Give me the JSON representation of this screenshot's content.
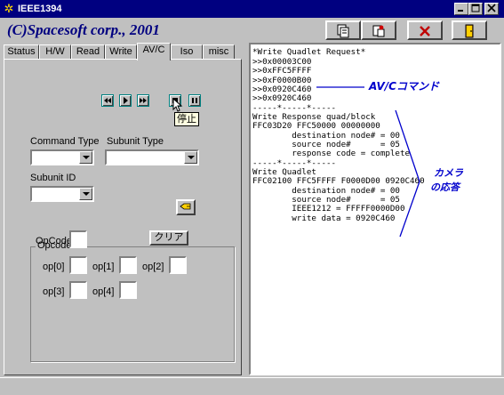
{
  "window": {
    "title": "IEEE1394",
    "controls": [
      "minimize",
      "maximize",
      "close"
    ]
  },
  "header": {
    "brand": "(C)Spacesoft corp., 2001",
    "toolbar": [
      "copy-log-icon",
      "paste-icon",
      "clear-x-icon",
      "exit-door-icon"
    ]
  },
  "tabs": [
    {
      "label": "Status"
    },
    {
      "label": "H/W"
    },
    {
      "label": "Read"
    },
    {
      "label": "Write"
    },
    {
      "label": "AV/C",
      "active": true
    },
    {
      "label": "Iso"
    },
    {
      "label": "misc"
    }
  ],
  "avc": {
    "media_buttons": [
      "rewind",
      "play",
      "fast-forward",
      "stop",
      "pause"
    ],
    "tooltip": "停止",
    "command_type_label": "Command Type",
    "command_type_value": "",
    "subunit_type_label": "Subunit Type",
    "subunit_type_value": "",
    "subunit_id_label": "Subunit ID",
    "subunit_id_value": "",
    "opcode": {
      "group_label": "Opcode",
      "opcode_label": "OpCode",
      "opcode_value": "",
      "clear_label": "クリア",
      "operands": [
        {
          "label": "op[0]",
          "value": ""
        },
        {
          "label": "op[1]",
          "value": ""
        },
        {
          "label": "op[2]",
          "value": ""
        },
        {
          "label": "op[3]",
          "value": ""
        },
        {
          "label": "op[4]",
          "value": ""
        }
      ]
    }
  },
  "log": {
    "lines": [
      "*Write Quadlet Request*",
      ">>0x00003C00",
      ">>0xFFC5FFFF",
      ">>0xF0000B00",
      ">>0x0920C460",
      ">>0x0920C460",
      "-----*-----*-----",
      "Write Response quad/block",
      "FFC03D20 FFC50000 00000000",
      "        destination node# = 00",
      "        source node#      = 05",
      "        response code = complete",
      "-----*-----*-----",
      "Write Quadlet",
      "FFC02100 FFC5FFFF F0000D00 0920C460",
      "        destination node# = 00",
      "        source node#      = 05",
      "        IEEE1212 = FFFFF0000D00",
      "        write data = 0920C460"
    ],
    "annotation_command": "AV/Cコマンド",
    "annotation_response_line1": "カメラ",
    "annotation_response_line2": "の応答"
  },
  "colors": {
    "titlebar": "#000080",
    "face": "#c0c0c0",
    "brand": "#000080",
    "annotation": "#0000cc",
    "media_button_border": "#008080"
  }
}
